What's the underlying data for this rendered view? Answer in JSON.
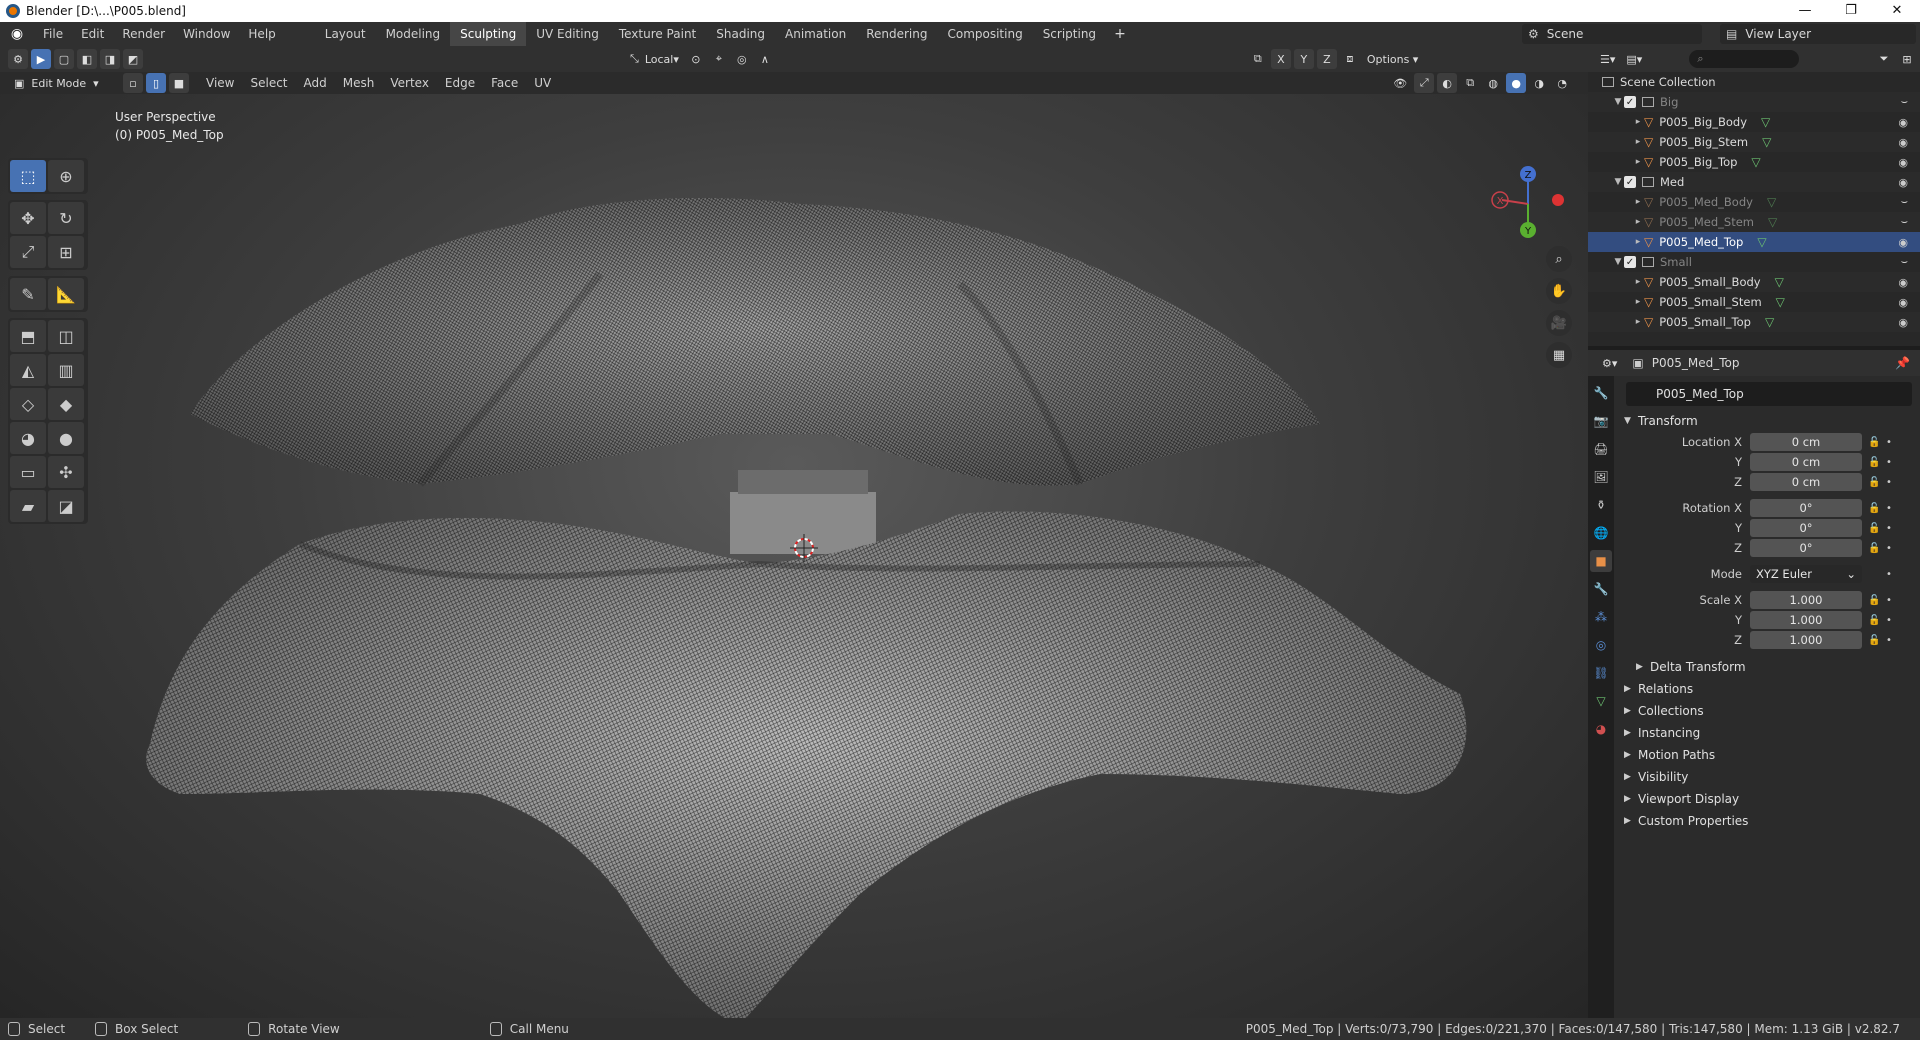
{
  "window": {
    "title": "Blender [D:\\...\\P005.blend]",
    "minimize": "—",
    "maximize": "❐",
    "close": "✕"
  },
  "topbar": {
    "menus": [
      "File",
      "Edit",
      "Render",
      "Window",
      "Help"
    ],
    "workspaces": [
      "Layout",
      "Modeling",
      "Sculpting",
      "UV Editing",
      "Texture Paint",
      "Shading",
      "Animation",
      "Rendering",
      "Compositing",
      "Scripting"
    ],
    "active_workspace": "Sculpting",
    "add_workspace": "+",
    "scene_label": "Scene",
    "view_layer_label": "View Layer"
  },
  "viewport_header": {
    "orientation": "Local",
    "options_label": "Options",
    "axis_x": "X",
    "axis_y": "Y",
    "axis_z": "Z"
  },
  "viewport_header2": {
    "mode": "Edit Mode",
    "menus": [
      "View",
      "Select",
      "Add",
      "Mesh",
      "Vertex",
      "Edge",
      "Face",
      "UV"
    ]
  },
  "viewport": {
    "perspective": "User Perspective",
    "object": "(0) P005_Med_Top",
    "gizmo_x": "X",
    "gizmo_y": "Y",
    "gizmo_z": "Z"
  },
  "outliner": {
    "root": "Scene Collection",
    "collections": [
      {
        "name": "Big",
        "objects": [
          "P005_Big_Body",
          "P005_Big_Stem",
          "P005_Big_Top"
        ]
      },
      {
        "name": "Med",
        "objects": [
          "P005_Med_Body",
          "P005_Med_Stem",
          "P005_Med_Top"
        ]
      },
      {
        "name": "Small",
        "objects": [
          "P005_Small_Body",
          "P005_Small_Stem",
          "P005_Small_Top"
        ]
      }
    ],
    "selected": "P005_Med_Top"
  },
  "properties": {
    "header_object": "P005_Med_Top",
    "object_name": "P005_Med_Top",
    "transform_label": "Transform",
    "location": {
      "label_x": "Location X",
      "label_y": "Y",
      "label_z": "Z",
      "x": "0 cm",
      "y": "0 cm",
      "z": "0 cm"
    },
    "rotation": {
      "label_x": "Rotation X",
      "label_y": "Y",
      "label_z": "Z",
      "x": "0°",
      "y": "0°",
      "z": "0°"
    },
    "mode": {
      "label": "Mode",
      "value": "XYZ Euler"
    },
    "scale": {
      "label_x": "Scale X",
      "label_y": "Y",
      "label_z": "Z",
      "x": "1.000",
      "y": "1.000",
      "z": "1.000"
    },
    "delta_transform": "Delta Transform",
    "panels": [
      "Relations",
      "Collections",
      "Instancing",
      "Motion Paths",
      "Visibility",
      "Viewport Display",
      "Custom Properties"
    ]
  },
  "statusbar": {
    "select": "Select",
    "box_select": "Box Select",
    "rotate_view": "Rotate View",
    "call_menu": "Call Menu",
    "stats": "P005_Med_Top | Verts:0/73,790 | Edges:0/221,370 | Faces:0/147,580 | Tris:147,580 | Mem: 1.13 GiB | v2.82.7"
  }
}
